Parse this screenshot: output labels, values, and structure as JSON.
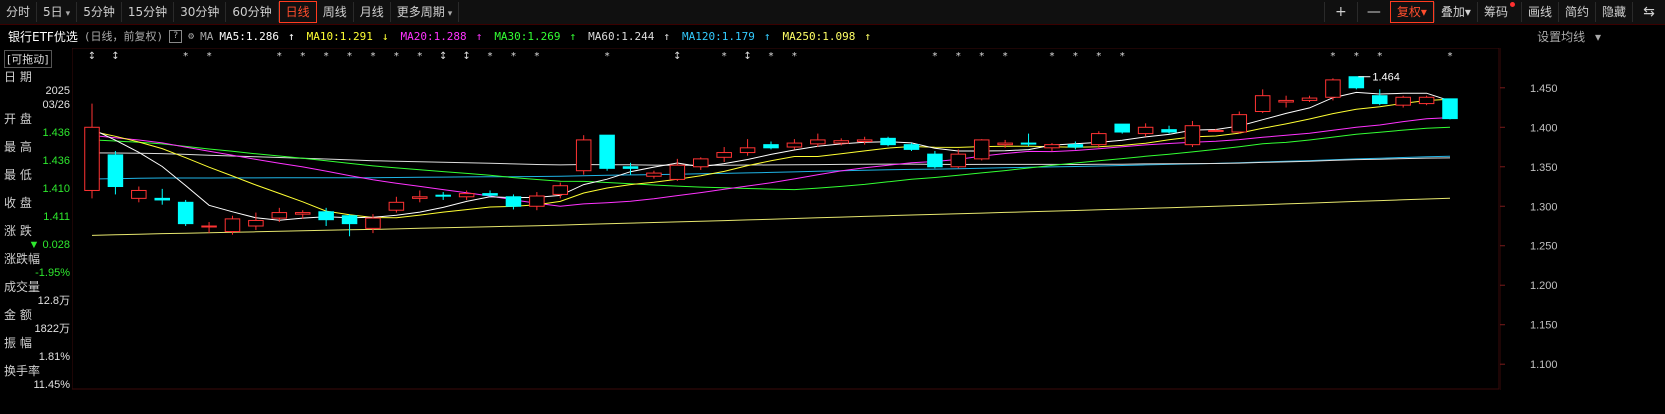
{
  "toolbar": {
    "buttons": [
      "分时",
      "5日",
      "5分钟",
      "15分钟",
      "30分钟",
      "60分钟",
      "日线",
      "周线",
      "月线",
      "更多周期"
    ],
    "active_index": 6,
    "caret_on": [
      1,
      9
    ],
    "right_buttons": [
      "复权",
      "叠加",
      "筹码",
      "画线",
      "简约",
      "隐藏"
    ],
    "plus": "+",
    "minus": "—"
  },
  "infobar": {
    "name": "银行ETF优选",
    "mode": "(日线，前复权)",
    "help": "?",
    "ma_label": "MA",
    "ma": [
      {
        "text": "MA5:1.286",
        "arrow": "↑",
        "color": "#ffffff"
      },
      {
        "text": "MA10:1.291",
        "arrow": "↓",
        "color": "#ffff33"
      },
      {
        "text": "MA20:1.288",
        "arrow": "↑",
        "color": "#ff33ff"
      },
      {
        "text": "MA30:1.269",
        "arrow": "↑",
        "color": "#33ff33"
      },
      {
        "text": "MA60:1.244",
        "arrow": "↑",
        "color": "#dcdcdc"
      },
      {
        "text": "MA120:1.179",
        "arrow": "↑",
        "color": "#33ccff"
      },
      {
        "text": "MA250:1.098",
        "arrow": "↑",
        "color": "#ffff66"
      }
    ],
    "settings": "设置均线"
  },
  "left_panel": {
    "tag": "[可拖动]",
    "date_label": "日  期",
    "date_year": "2025",
    "date_md": "03/26",
    "fields": [
      {
        "label": "开  盘",
        "value": "1.436",
        "color": "green"
      },
      {
        "label": "最  高",
        "value": "1.436",
        "color": "green"
      },
      {
        "label": "最  低",
        "value": "1.410",
        "color": "green"
      },
      {
        "label": "收  盘",
        "value": "1.411",
        "color": "green"
      },
      {
        "label": "涨  跌",
        "value": "▼ 0.028",
        "color": "green"
      },
      {
        "label": "涨跌幅",
        "value": "-1.95%",
        "color": "green"
      },
      {
        "label": "成交量",
        "value": "12.8万",
        "color": "white"
      },
      {
        "label": "金  额",
        "value": "1822万",
        "color": "white"
      },
      {
        "label": "振  幅",
        "value": "1.81%",
        "color": "white"
      },
      {
        "label": "换手率",
        "value": "11.45%",
        "color": "white"
      }
    ]
  },
  "colors": {
    "up": "#ff3333",
    "down": "#00ffff",
    "ma5": "#ffffff",
    "ma10": "#ffff33",
    "ma20": "#ff33ff",
    "ma30": "#33ff33",
    "ma60": "#dcdcdc",
    "ma120": "#1fb4e6",
    "ma250": "#e6e66e",
    "background": "#000000",
    "grid_red": "#3a0a0a"
  },
  "chart_data": {
    "type": "candlestick",
    "ylim": [
      1.08,
      1.47
    ],
    "yticks": [
      "1.100",
      "1.150",
      "1.200",
      "1.250",
      "1.300",
      "1.350",
      "1.400",
      "1.450"
    ],
    "max_label": "1.464",
    "candles": [
      {
        "o": 1.32,
        "h": 1.43,
        "l": 1.31,
        "c": 1.4
      },
      {
        "o": 1.365,
        "h": 1.37,
        "l": 1.315,
        "c": 1.325
      },
      {
        "o": 1.31,
        "h": 1.325,
        "l": 1.305,
        "c": 1.32
      },
      {
        "o": 1.31,
        "h": 1.322,
        "l": 1.302,
        "c": 1.308
      },
      {
        "o": 1.305,
        "h": 1.308,
        "l": 1.275,
        "c": 1.278
      },
      {
        "o": 1.274,
        "h": 1.28,
        "l": 1.266,
        "c": 1.275
      },
      {
        "o": 1.268,
        "h": 1.288,
        "l": 1.264,
        "c": 1.284
      },
      {
        "o": 1.275,
        "h": 1.292,
        "l": 1.27,
        "c": 1.282
      },
      {
        "o": 1.285,
        "h": 1.298,
        "l": 1.28,
        "c": 1.292
      },
      {
        "o": 1.29,
        "h": 1.295,
        "l": 1.284,
        "c": 1.292
      },
      {
        "o": 1.293,
        "h": 1.298,
        "l": 1.275,
        "c": 1.283
      },
      {
        "o": 1.288,
        "h": 1.29,
        "l": 1.262,
        "c": 1.278
      },
      {
        "o": 1.272,
        "h": 1.29,
        "l": 1.266,
        "c": 1.285
      },
      {
        "o": 1.295,
        "h": 1.312,
        "l": 1.292,
        "c": 1.305
      },
      {
        "o": 1.31,
        "h": 1.32,
        "l": 1.305,
        "c": 1.312
      },
      {
        "o": 1.314,
        "h": 1.318,
        "l": 1.308,
        "c": 1.313
      },
      {
        "o": 1.312,
        "h": 1.32,
        "l": 1.308,
        "c": 1.316
      },
      {
        "o": 1.316,
        "h": 1.32,
        "l": 1.312,
        "c": 1.314
      },
      {
        "o": 1.312,
        "h": 1.315,
        "l": 1.296,
        "c": 1.3
      },
      {
        "o": 1.3,
        "h": 1.318,
        "l": 1.295,
        "c": 1.313
      },
      {
        "o": 1.315,
        "h": 1.33,
        "l": 1.31,
        "c": 1.326
      },
      {
        "o": 1.345,
        "h": 1.39,
        "l": 1.34,
        "c": 1.384
      },
      {
        "o": 1.39,
        "h": 1.39,
        "l": 1.345,
        "c": 1.348
      },
      {
        "o": 1.35,
        "h": 1.355,
        "l": 1.34,
        "c": 1.348
      },
      {
        "o": 1.338,
        "h": 1.345,
        "l": 1.335,
        "c": 1.342
      },
      {
        "o": 1.334,
        "h": 1.36,
        "l": 1.332,
        "c": 1.352
      },
      {
        "o": 1.35,
        "h": 1.362,
        "l": 1.346,
        "c": 1.36
      },
      {
        "o": 1.362,
        "h": 1.375,
        "l": 1.356,
        "c": 1.368
      },
      {
        "o": 1.368,
        "h": 1.385,
        "l": 1.364,
        "c": 1.374
      },
      {
        "o": 1.378,
        "h": 1.382,
        "l": 1.372,
        "c": 1.374
      },
      {
        "o": 1.375,
        "h": 1.385,
        "l": 1.372,
        "c": 1.38
      },
      {
        "o": 1.379,
        "h": 1.392,
        "l": 1.375,
        "c": 1.384
      },
      {
        "o": 1.38,
        "h": 1.386,
        "l": 1.377,
        "c": 1.383
      },
      {
        "o": 1.382,
        "h": 1.388,
        "l": 1.378,
        "c": 1.384
      },
      {
        "o": 1.386,
        "h": 1.388,
        "l": 1.376,
        "c": 1.378
      },
      {
        "o": 1.378,
        "h": 1.38,
        "l": 1.37,
        "c": 1.372
      },
      {
        "o": 1.366,
        "h": 1.37,
        "l": 1.348,
        "c": 1.35
      },
      {
        "o": 1.35,
        "h": 1.372,
        "l": 1.348,
        "c": 1.366
      },
      {
        "o": 1.36,
        "h": 1.385,
        "l": 1.358,
        "c": 1.384
      },
      {
        "o": 1.378,
        "h": 1.384,
        "l": 1.374,
        "c": 1.38
      },
      {
        "o": 1.38,
        "h": 1.392,
        "l": 1.376,
        "c": 1.379
      },
      {
        "o": 1.374,
        "h": 1.38,
        "l": 1.37,
        "c": 1.378
      },
      {
        "o": 1.378,
        "h": 1.382,
        "l": 1.372,
        "c": 1.375
      },
      {
        "o": 1.378,
        "h": 1.395,
        "l": 1.374,
        "c": 1.392
      },
      {
        "o": 1.404,
        "h": 1.404,
        "l": 1.392,
        "c": 1.394
      },
      {
        "o": 1.392,
        "h": 1.405,
        "l": 1.388,
        "c": 1.4
      },
      {
        "o": 1.397,
        "h": 1.402,
        "l": 1.392,
        "c": 1.394
      },
      {
        "o": 1.378,
        "h": 1.408,
        "l": 1.375,
        "c": 1.402
      },
      {
        "o": 1.396,
        "h": 1.398,
        "l": 1.394,
        "c": 1.396
      },
      {
        "o": 1.394,
        "h": 1.42,
        "l": 1.392,
        "c": 1.416
      },
      {
        "o": 1.42,
        "h": 1.448,
        "l": 1.418,
        "c": 1.44
      },
      {
        "o": 1.432,
        "h": 1.44,
        "l": 1.425,
        "c": 1.434
      },
      {
        "o": 1.434,
        "h": 1.44,
        "l": 1.432,
        "c": 1.437
      },
      {
        "o": 1.438,
        "h": 1.462,
        "l": 1.434,
        "c": 1.46
      },
      {
        "o": 1.464,
        "h": 1.464,
        "l": 1.448,
        "c": 1.45
      },
      {
        "o": 1.44,
        "h": 1.448,
        "l": 1.428,
        "c": 1.43
      },
      {
        "o": 1.428,
        "h": 1.44,
        "l": 1.425,
        "c": 1.438
      },
      {
        "o": 1.43,
        "h": 1.44,
        "l": 1.428,
        "c": 1.438
      },
      {
        "o": 1.436,
        "h": 1.436,
        "l": 1.41,
        "c": 1.411
      }
    ],
    "markers": [
      "↕",
      "↕",
      "",
      "",
      "*",
      "*",
      "",
      "",
      "*",
      "*",
      "*",
      "*",
      "*",
      "*",
      "*",
      "↕",
      "↕",
      "*",
      "*",
      "*",
      "",
      "",
      "*",
      "",
      "",
      "↕",
      "",
      "*",
      "↕",
      "*",
      "*",
      "",
      "",
      "",
      "",
      "",
      "*",
      "*",
      "*",
      "*",
      "",
      "*",
      "*",
      "*",
      "*",
      "",
      "",
      "",
      "",
      "",
      "",
      "",
      "",
      "*",
      "*",
      "*",
      "",
      "",
      "*"
    ]
  }
}
